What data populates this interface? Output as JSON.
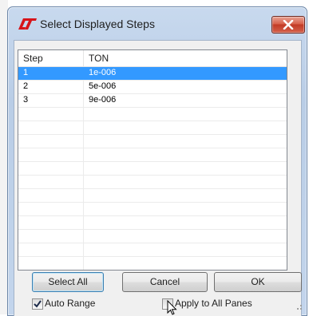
{
  "dialog": {
    "title": "Select Displayed Steps"
  },
  "table": {
    "columns": [
      "Step",
      "TON"
    ],
    "rows": [
      {
        "step": "1",
        "ton": "1e-006",
        "selected": true
      },
      {
        "step": "2",
        "ton": "5e-006",
        "selected": false
      },
      {
        "step": "3",
        "ton": "9e-006",
        "selected": false
      }
    ],
    "empty_rows_visible": 13
  },
  "buttons": {
    "select_all": "Select All",
    "cancel": "Cancel",
    "ok": "OK"
  },
  "options": {
    "auto_range_label": "Auto Range",
    "auto_range_checked": true,
    "apply_all_label": "Apply to All Panes",
    "apply_all_checked": false
  },
  "colors": {
    "selection": "#3399ff",
    "close_button": "#c7432d",
    "logo": "#d7141a"
  },
  "icons": {
    "app_logo": "lt-logo-icon",
    "close": "close-icon",
    "checkmark": "checkmark-icon",
    "cursor": "mouse-pointer-icon",
    "resize": "resize-grip-icon"
  }
}
